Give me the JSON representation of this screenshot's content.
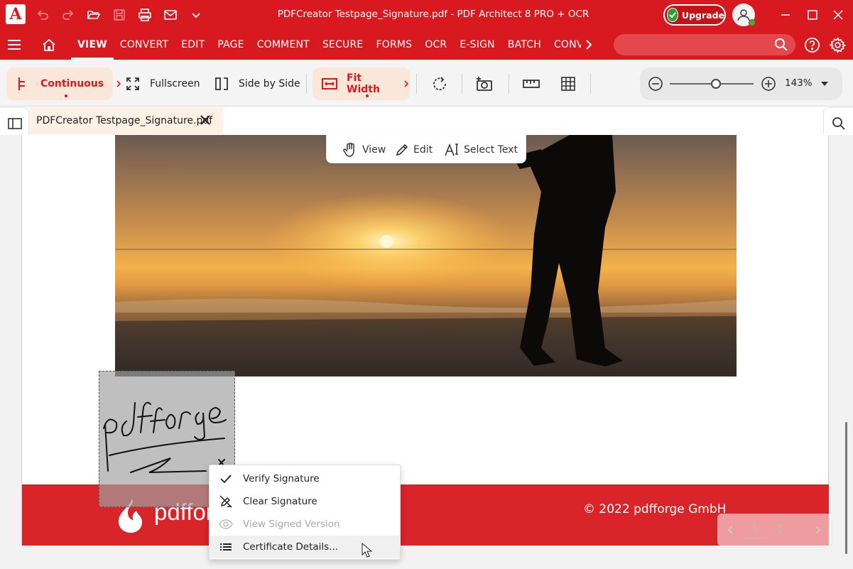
{
  "window": {
    "title": "PDFCreator Testpage_Signature.pdf   -   PDF Architect 8 PRO + OCR",
    "upgrade_label": "Upgrade",
    "logo_glyph": "A"
  },
  "menu": {
    "tabs": [
      {
        "label": "VIEW",
        "active": true
      },
      {
        "label": "CONVERT"
      },
      {
        "label": "EDIT"
      },
      {
        "label": "PAGE"
      },
      {
        "label": "COMMENT"
      },
      {
        "label": "SECURE"
      },
      {
        "label": "FORMS"
      },
      {
        "label": "OCR"
      },
      {
        "label": "E-SIGN"
      },
      {
        "label": "BATCH"
      },
      {
        "label": "CONVERT"
      }
    ],
    "search_placeholder": ""
  },
  "toolbar": {
    "continuous": "Continuous",
    "fullscreen": "Fullscreen",
    "side_by_side": "Side by Side",
    "fit_width": "Fit Width",
    "zoom_value": "143%",
    "zoom_fraction": 0.55
  },
  "document": {
    "tab_label": "PDFCreator Testpage_Signature.pdf",
    "copyright": "© 2022 pdfforge GmbH",
    "brand_text": "pdfforge",
    "signature_text": "pdfforge"
  },
  "mode_bar": {
    "view": "View",
    "edit": "Edit",
    "select_text": "Select Text"
  },
  "context_menu": {
    "items": [
      {
        "label": "Verify Signature",
        "icon": "check-icon",
        "disabled": false
      },
      {
        "label": "Clear Signature",
        "icon": "clear-signature-icon",
        "disabled": false
      },
      {
        "label": "View Signed Version",
        "icon": "eye-icon",
        "disabled": true
      },
      {
        "label": "Certificate Details...",
        "icon": "list-icon",
        "disabled": false
      }
    ]
  },
  "pagenav": {
    "current": "1",
    "total": "/ 1"
  },
  "colors": {
    "brand_red": "#d8191f",
    "footer_red": "#d9242a",
    "pill_bg": "#fbe7d9",
    "upgrade_green": "#2e9e3a"
  }
}
